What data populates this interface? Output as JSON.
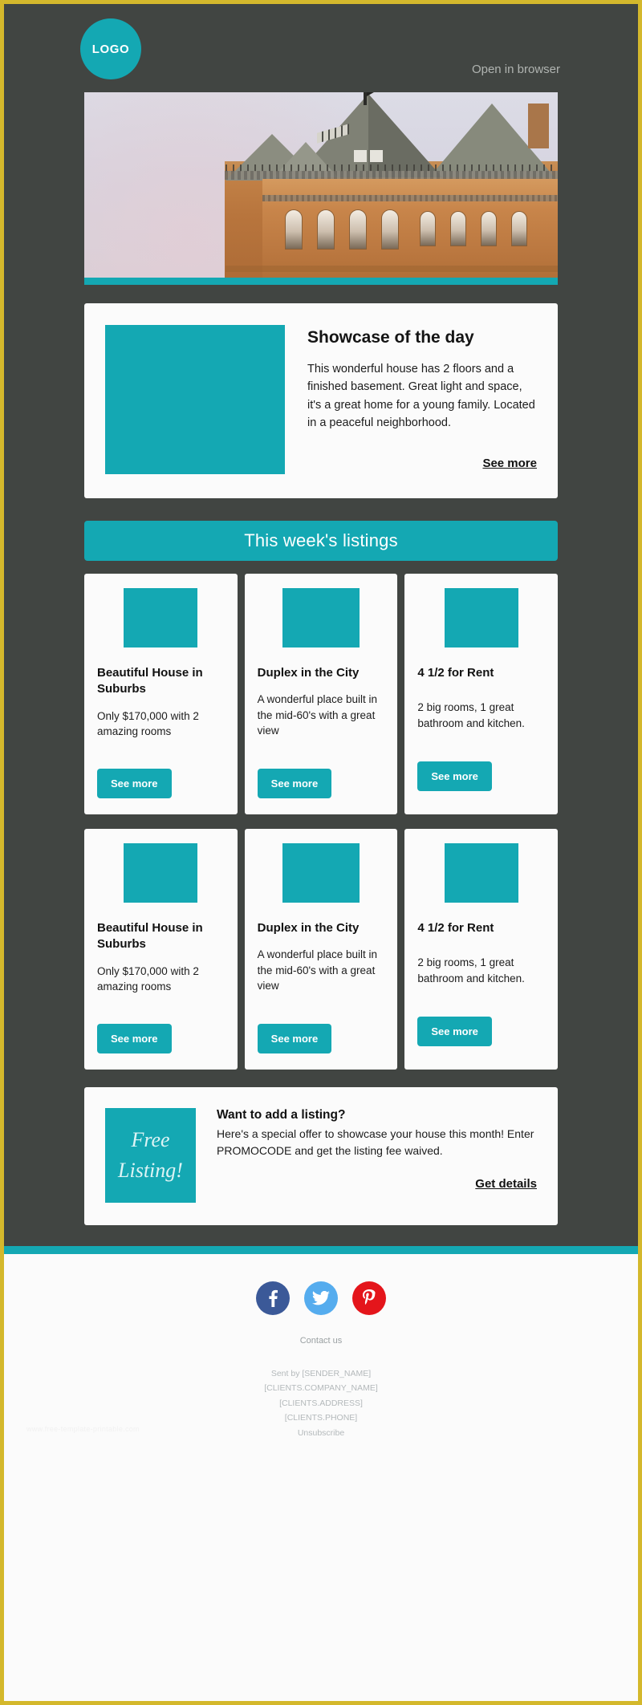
{
  "theme": {
    "accent": "#14a8b3",
    "dark_bg": "#414542",
    "page_border": "#d4b82c",
    "card_bg": "#fbfbfb",
    "facebook": "#3b5998",
    "twitter": "#55acee",
    "pinterest": "#e4151b"
  },
  "header": {
    "logo_text": "LOGO",
    "open_in_browser": "Open in browser"
  },
  "hero": {
    "alt": "Brick mansion with slate turret roof against a pale sky"
  },
  "showcase": {
    "title": "Showcase of the day",
    "text": "This wonderful house has 2 floors and a finished basement. Great light and space, it's a great home for a young family. Located in a peaceful neighborhood.",
    "link_label": "See more"
  },
  "section_banner": {
    "title": "This week's listings"
  },
  "listings": [
    {
      "title": "Beautiful House in Suburbs",
      "text": "Only $170,000 with 2 amazing rooms",
      "button_label": "See more"
    },
    {
      "title": "Duplex in the City",
      "text": "A wonderful place built in the mid-60's with a great view",
      "button_label": "See more"
    },
    {
      "title": "4 1/2 for Rent",
      "text": "2 big rooms, 1 great bathroom and kitchen.",
      "button_label": "See more"
    },
    {
      "title": "Beautiful House in Suburbs",
      "text": "Only $170,000 with 2 amazing rooms",
      "button_label": "See more"
    },
    {
      "title": "Duplex in the City",
      "text": "A wonderful place built in the mid-60's with a great view",
      "button_label": "See more"
    },
    {
      "title": "4 1/2 for Rent",
      "text": "2 big rooms, 1 great bathroom and kitchen.",
      "button_label": "See more"
    }
  ],
  "promo": {
    "badge_line1": "Free",
    "badge_line2": "Listing!",
    "title": "Want to add a listing?",
    "text": "Here's a special offer to showcase your house this month! Enter PROMOCODE and get the listing fee waived.",
    "link_label": "Get details"
  },
  "footer": {
    "social": [
      {
        "name": "facebook",
        "glyph": "f"
      },
      {
        "name": "twitter",
        "glyph": "t"
      },
      {
        "name": "pinterest",
        "glyph": "p"
      }
    ],
    "contact_label": "Contact us",
    "sent_by": "Sent by [SENDER_NAME]",
    "company": "[CLIENTS.COMPANY_NAME]",
    "address": "[CLIENTS.ADDRESS]",
    "phone": "[CLIENTS.PHONE]",
    "unsubscribe": "Unsubscribe",
    "watermark": "www.free-template-printable.com"
  }
}
